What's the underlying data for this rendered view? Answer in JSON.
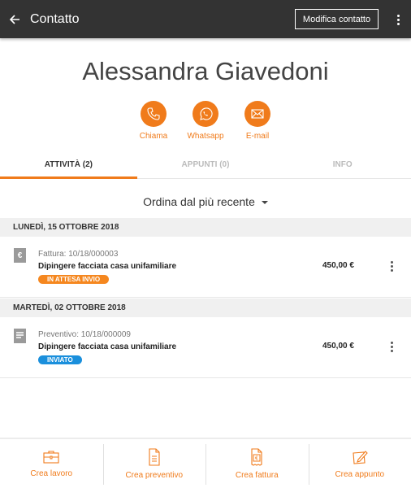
{
  "appbar": {
    "title": "Contatto",
    "edit_button": "Modifica contatto",
    "back_icon": "arrow-left-icon",
    "menu_icon": "more-vert-icon"
  },
  "contact": {
    "name": "Alessandra Giavedoni"
  },
  "actions": [
    {
      "label": "Chiama",
      "icon": "phone-icon"
    },
    {
      "label": "Whatsapp",
      "icon": "whatsapp-icon"
    },
    {
      "label": "E-mail",
      "icon": "mail-icon"
    }
  ],
  "tabs": [
    {
      "label": "ATTIVITÀ (2)",
      "active": true
    },
    {
      "label": "APPUNTI (0)",
      "active": false
    },
    {
      "label": "INFO",
      "active": false
    }
  ],
  "sort": {
    "label": "Ordina dal più recente"
  },
  "groups": [
    {
      "date": "LUNEDÌ, 15 OTTOBRE 2018",
      "items": [
        {
          "icon": "invoice-icon",
          "type": "Fattura: 10/18/000003",
          "description": "Dipingere facciata casa unifamiliare",
          "status": "IN ATTESA INVIO",
          "status_color": "#f5871f",
          "amount": "450,00 €"
        }
      ]
    },
    {
      "date": "MARTEDÌ, 02 OTTOBRE 2018",
      "items": [
        {
          "icon": "quote-document-icon",
          "type": "Preventivo: 10/18/000009",
          "description": "Dipingere facciata casa unifamiliare",
          "status": "INVIATO",
          "status_color": "#1a8fdc",
          "amount": "450,00 €"
        }
      ]
    }
  ],
  "bottom_bar": [
    {
      "label": "Crea lavoro",
      "icon": "briefcase-icon"
    },
    {
      "label": "Crea preventivo",
      "icon": "document-icon"
    },
    {
      "label": "Crea fattura",
      "icon": "invoice-icon"
    },
    {
      "label": "Crea appunto",
      "icon": "note-edit-icon"
    }
  ],
  "colors": {
    "accent": "#f07b1b",
    "appbar": "#333333"
  }
}
